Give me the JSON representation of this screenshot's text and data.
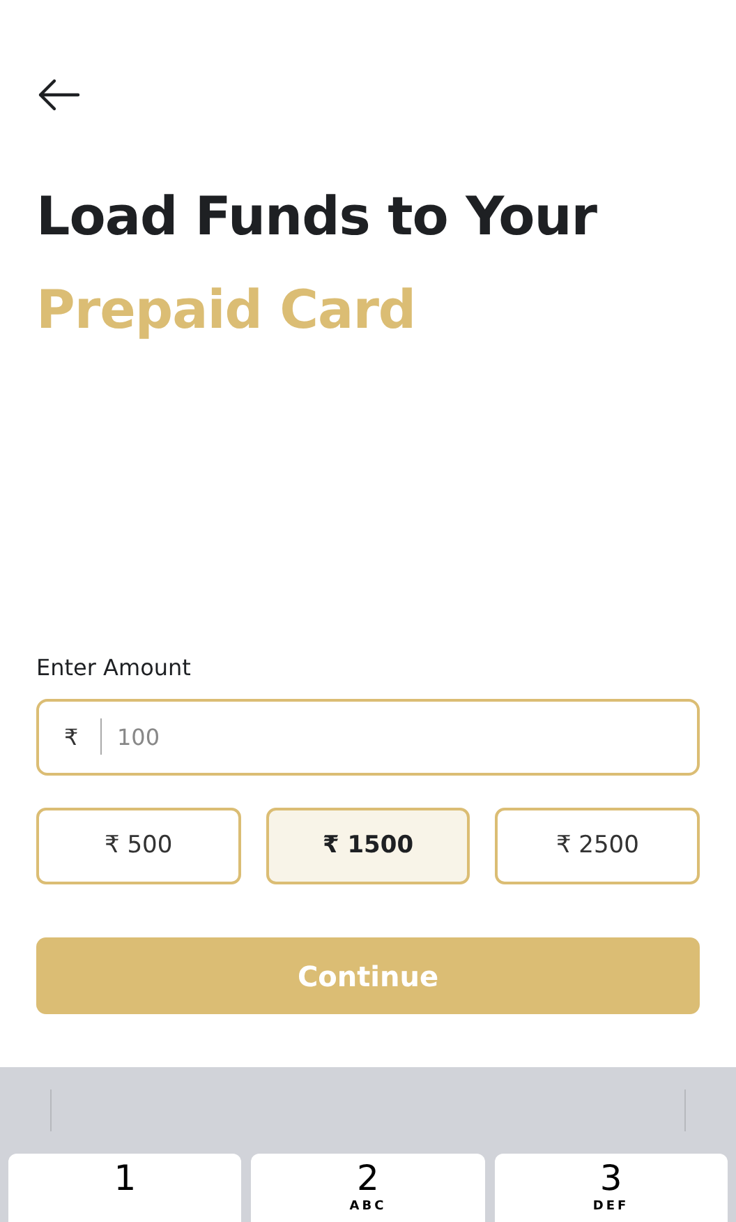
{
  "title": {
    "line_1": "Load Funds to Your",
    "line_2": "Prepaid Card"
  },
  "amount_field": {
    "label": "Enter Amount",
    "currency": "₹",
    "placeholder": "100"
  },
  "presets": [
    {
      "label": "₹ 500",
      "selected": false
    },
    {
      "label": "₹ 1500",
      "selected": true
    },
    {
      "label": "₹ 2500",
      "selected": false
    }
  ],
  "continue_button": "Continue",
  "keyboard": {
    "keys": [
      {
        "digit": "1"
      },
      {
        "digit": "2",
        "letters": "ABC"
      },
      {
        "digit": "3",
        "letters": "DEF"
      }
    ]
  }
}
